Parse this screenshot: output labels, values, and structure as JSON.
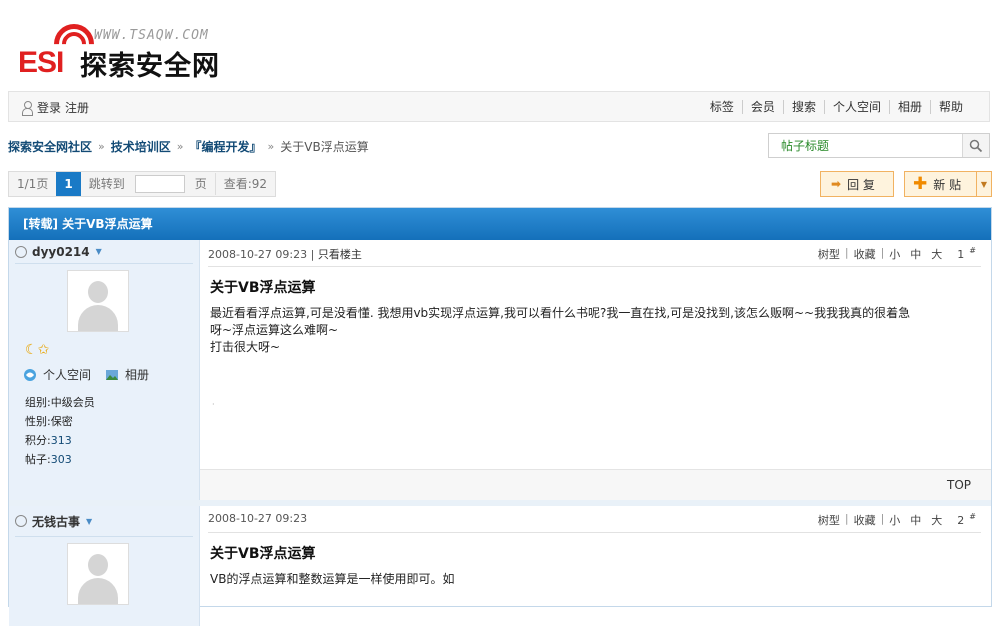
{
  "logo": {
    "url_text": "WWW.TSAQW.COM",
    "brand_mark": "ESI",
    "brand_name": "探索安全网"
  },
  "topnav": {
    "login": "登录",
    "register": "注册",
    "links": [
      "标签",
      "会员",
      "搜索",
      "个人空间",
      "相册",
      "帮助"
    ]
  },
  "breadcrumb": {
    "items": [
      "探索安全网社区",
      "技术培训区",
      "『编程开发』"
    ],
    "separator": "»",
    "current": "关于VB浮点运算"
  },
  "search": {
    "placeholder": "帖子标题"
  },
  "pager": {
    "pages": "1/1页",
    "current": "1",
    "jump_label": "跳转到",
    "page_unit": "页",
    "views": "查看:92"
  },
  "actions": {
    "reply": "回 复",
    "new_post": "新 贴"
  },
  "thread": {
    "title": "[转载] 关于VB浮点运算"
  },
  "posts": [
    {
      "user": "dyy0214",
      "space": "个人空间",
      "album": "相册",
      "group": "组别:中级会员",
      "gender": "性别:保密",
      "points_label": "积分:",
      "points": "313",
      "posts_label": "帖子:",
      "posts": "303",
      "date": "2008-10-27 09:23",
      "only_author": "只看楼主",
      "tools": [
        "树型",
        "收藏",
        "小",
        "中",
        "大"
      ],
      "floor": "1",
      "title": "关于VB浮点运算",
      "body_line1": "最近看看浮点运算,可是没看懂. 我想用vb实现浮点运算,我可以看什么书呢?我一直在找,可是没找到,该怎么贩啊~~我我我真的很着急",
      "body_line2": "呀~浮点运算这么难啊~",
      "body_line3": "打击很大呀~",
      "top": "TOP"
    },
    {
      "user": "无钱古事",
      "date": "2008-10-27 09:23",
      "tools": [
        "树型",
        "收藏",
        "小",
        "中",
        "大"
      ],
      "floor": "2",
      "title": "关于VB浮点运算",
      "body_line1": "VB的浮点运算和整数运算是一样使用即可。如"
    }
  ],
  "colors": {
    "accent": "#1a7ac6",
    "link": "#124a75",
    "button_border": "#f1b261",
    "button_bg": "#fef3dd"
  }
}
